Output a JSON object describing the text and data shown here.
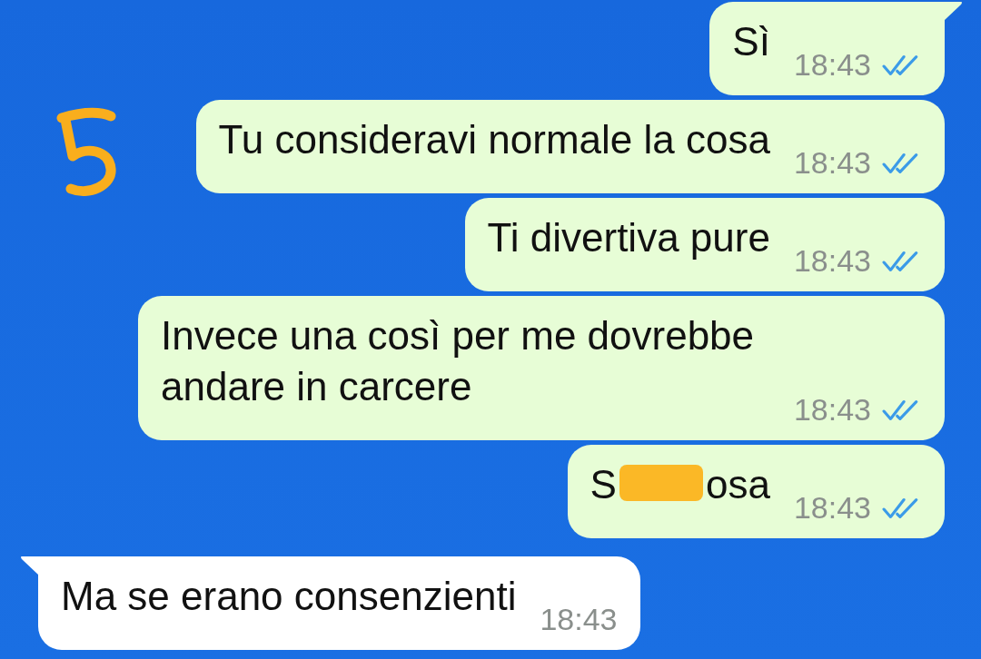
{
  "messages": [
    {
      "kind": "out",
      "text": "Sì",
      "time": "18:43",
      "read": true,
      "tail": true,
      "annotated": false
    },
    {
      "kind": "out",
      "text": "Tu consideravi normale la cosa",
      "time": "18:43",
      "read": true,
      "tail": false,
      "annotated": true
    },
    {
      "kind": "out",
      "text": "Ti divertiva pure",
      "time": "18:43",
      "read": true,
      "tail": false,
      "annotated": false
    },
    {
      "kind": "out",
      "text": "Invece una così per me dovrebbe andare in carcere",
      "time": "18:43",
      "read": true,
      "tail": false,
      "annotated": false
    },
    {
      "kind": "out",
      "text": "S",
      "text_after": "osa",
      "redacted": true,
      "time": "18:43",
      "read": true,
      "tail": false,
      "annotated": false
    },
    {
      "kind": "in",
      "text": "Ma se erano consenzienti",
      "time": "18:43",
      "tail": true,
      "annotated": false
    }
  ]
}
